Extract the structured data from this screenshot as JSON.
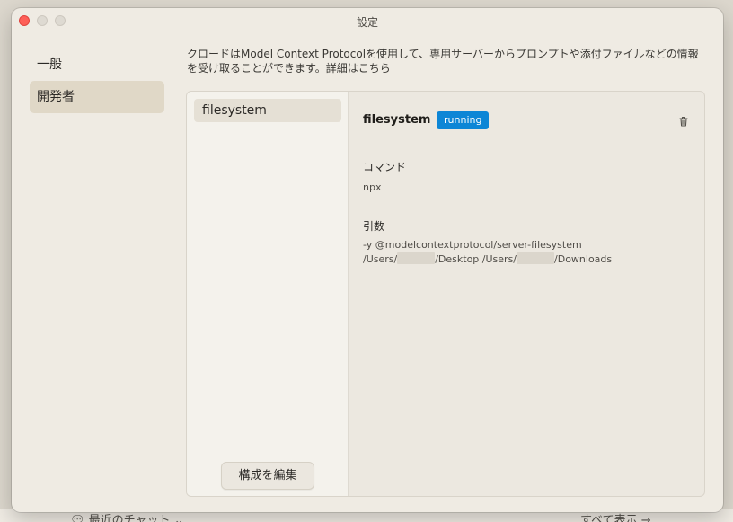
{
  "window": {
    "title": "設定"
  },
  "sidebar": {
    "items": [
      {
        "label": "一般"
      },
      {
        "label": "開発者"
      }
    ]
  },
  "description": "クロードはModel Context Protocolを使用して、専用サーバーからプロンプトや添付ファイルなどの情報を受け取ることができます。詳細はこちら",
  "servers": [
    {
      "name": "filesystem"
    }
  ],
  "edit_button": "構成を編集",
  "detail": {
    "name": "filesystem",
    "status": "running",
    "status_color": "#0d86d6",
    "command_label": "コマンド",
    "command": "npx",
    "args_label": "引数",
    "args_line1": "-y @modelcontextprotocol/server-filesystem",
    "args_seg1": "/Users/",
    "args_seg2": "/Desktop /Users/",
    "args_seg3": "/Downloads",
    "delete_icon": "trash-icon"
  },
  "background": {
    "recent_chats": "最近のチャット",
    "view_all": "すべて表示 →"
  }
}
